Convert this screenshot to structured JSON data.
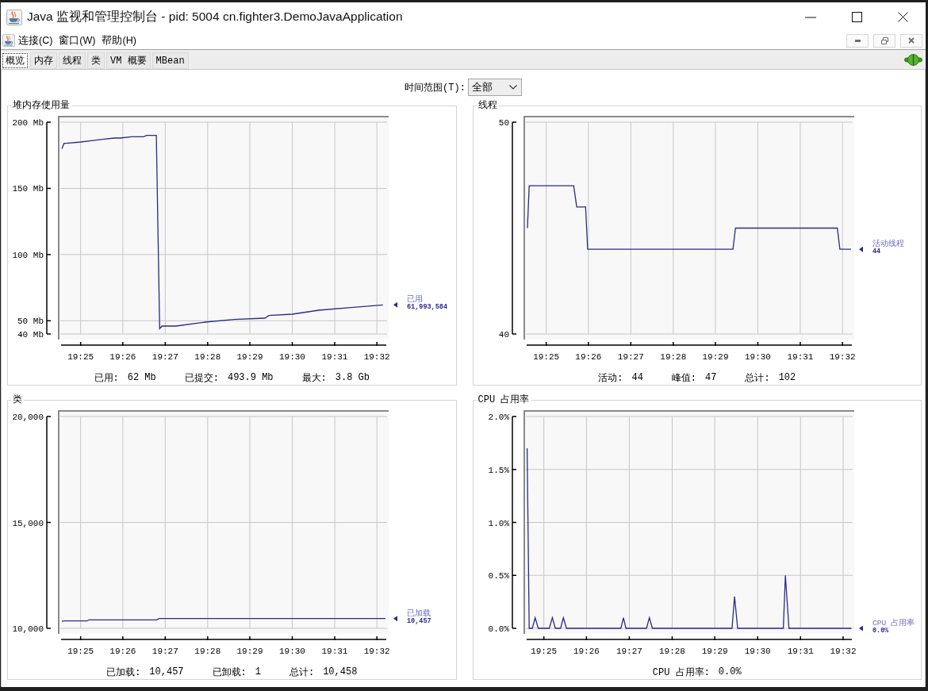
{
  "window": {
    "title": "Java 监视和管理控制台 - pid: 5004 cn.fighter3.DemoJavaApplication"
  },
  "menu": [
    {
      "label": "连接(C)"
    },
    {
      "label": "窗口(W)"
    },
    {
      "label": "帮助(H)"
    }
  ],
  "tabs": [
    {
      "label": "概览",
      "selected": true
    },
    {
      "label": "内存",
      "selected": false
    },
    {
      "label": "线程",
      "selected": false
    },
    {
      "label": "类",
      "selected": false
    },
    {
      "label": "VM 概要",
      "selected": false
    },
    {
      "label": "MBean",
      "selected": false
    }
  ],
  "time_range": {
    "label": "时间范围(T):",
    "value": "全部"
  },
  "panels": [
    {
      "title": "堆内存使用量",
      "legend_value": "61,993,584",
      "chart_data": {
        "type": "line",
        "xlim": [
          19.409,
          19.537
        ],
        "ylim": [
          40,
          200
        ],
        "xticks": [
          {
            "value": 19.4167,
            "label": "19:25"
          },
          {
            "value": 19.4333,
            "label": "19:26"
          },
          {
            "value": 19.45,
            "label": "19:27"
          },
          {
            "value": 19.4667,
            "label": "19:28"
          },
          {
            "value": 19.4833,
            "label": "19:29"
          },
          {
            "value": 19.5,
            "label": "19:30"
          },
          {
            "value": 19.5167,
            "label": "19:31"
          },
          {
            "value": 19.5333,
            "label": "19:32"
          }
        ],
        "yticks": [
          {
            "value": 200,
            "label": "200 Mb"
          },
          {
            "value": 150,
            "label": "150 Mb"
          },
          {
            "value": 100,
            "label": "100 Mb"
          },
          {
            "value": 50,
            "label": "50 Mb"
          },
          {
            "value": 40,
            "label": "40 Mb"
          }
        ],
        "grid": true,
        "legend": "right",
        "series": [
          {
            "name": "已用",
            "color": "#2a2a8c",
            "x": [
              19.4093,
              19.4102,
              19.411,
              19.4167,
              19.4208,
              19.4253,
              19.43,
              19.4323,
              19.4368,
              19.4415,
              19.4427,
              19.4465,
              19.4478,
              19.4487,
              19.4542,
              19.4657,
              19.4772,
              19.4892,
              19.4908,
              19.5,
              19.5105,
              19.5232,
              19.5357
            ],
            "values": [
              180,
              184,
              184,
              185,
              186,
              187,
              188,
              188,
              189,
              189,
              190,
              190,
              44,
              46,
              46,
              49,
              51,
              52,
              54,
              55,
              58,
              60,
              62
            ]
          }
        ]
      },
      "stats": [
        {
          "label": "已用:",
          "value": "62 Mb"
        },
        {
          "label": "已提交:",
          "value": "493.9 Mb"
        },
        {
          "label": "最大:",
          "value": "3.8 Gb"
        }
      ]
    },
    {
      "title": "线程",
      "legend_value": "44",
      "chart_data": {
        "type": "line",
        "xlim": [
          19.409,
          19.537
        ],
        "ylim": [
          40,
          50
        ],
        "xticks": [
          {
            "value": 19.4167,
            "label": "19:25"
          },
          {
            "value": 19.4333,
            "label": "19:26"
          },
          {
            "value": 19.45,
            "label": "19:27"
          },
          {
            "value": 19.4667,
            "label": "19:28"
          },
          {
            "value": 19.4833,
            "label": "19:29"
          },
          {
            "value": 19.5,
            "label": "19:30"
          },
          {
            "value": 19.5167,
            "label": "19:31"
          },
          {
            "value": 19.5333,
            "label": "19:32"
          }
        ],
        "yticks": [
          50,
          40
        ],
        "grid": true,
        "legend": "right",
        "series": [
          {
            "name": "活动线程",
            "color": "#2a2a8c",
            "x": [
              19.4093,
              19.41,
              19.4275,
              19.4287,
              19.4322,
              19.433,
              19.4902,
              19.4912,
              19.5313,
              19.5323,
              19.5367
            ],
            "values": [
              45,
              47,
              47,
              46,
              46,
              44,
              44,
              45,
              45,
              44,
              44
            ]
          }
        ]
      },
      "stats": [
        {
          "label": "活动:",
          "value": "44"
        },
        {
          "label": "峰值:",
          "value": "47"
        },
        {
          "label": "总计:",
          "value": "102"
        }
      ]
    },
    {
      "title": "类",
      "legend_value": "10,457",
      "chart_data": {
        "type": "line",
        "xlim": [
          19.409,
          19.537
        ],
        "ylim": [
          10000,
          20000
        ],
        "xticks": [
          {
            "value": 19.4167,
            "label": "19:25"
          },
          {
            "value": 19.4333,
            "label": "19:26"
          },
          {
            "value": 19.45,
            "label": "19:27"
          },
          {
            "value": 19.4667,
            "label": "19:28"
          },
          {
            "value": 19.4833,
            "label": "19:29"
          },
          {
            "value": 19.5,
            "label": "19:30"
          },
          {
            "value": 19.5167,
            "label": "19:31"
          },
          {
            "value": 19.5333,
            "label": "19:32"
          }
        ],
        "yticks": [
          {
            "value": 20000,
            "label": "20,000"
          },
          {
            "value": 15000,
            "label": "15,000"
          },
          {
            "value": 10000,
            "label": "10,000"
          }
        ],
        "grid": true,
        "legend": "right",
        "series": [
          {
            "name": "已加载",
            "color": "#2a2a8c",
            "x": [
              19.4093,
              19.41,
              19.4192,
              19.42,
              19.4467,
              19.4475,
              19.5367
            ],
            "values": [
              10330,
              10350,
              10350,
              10400,
              10400,
              10460,
              10460
            ]
          }
        ]
      },
      "stats": [
        {
          "label": "已加载:",
          "value": "10,457"
        },
        {
          "label": "已卸载:",
          "value": "1"
        },
        {
          "label": "总计:",
          "value": "10,458"
        }
      ]
    },
    {
      "title": "CPU 占用率",
      "legend_value": "0.0%",
      "chart_data": {
        "type": "line",
        "xlim": [
          19.41,
          19.5367
        ],
        "ylim": [
          0,
          2
        ],
        "xticks": [
          {
            "value": 19.4167,
            "label": "19:25"
          },
          {
            "value": 19.4333,
            "label": "19:26"
          },
          {
            "value": 19.45,
            "label": "19:27"
          },
          {
            "value": 19.4667,
            "label": "19:28"
          },
          {
            "value": 19.4833,
            "label": "19:29"
          },
          {
            "value": 19.5,
            "label": "19:30"
          },
          {
            "value": 19.5167,
            "label": "19:31"
          },
          {
            "value": 19.5333,
            "label": "19:32"
          }
        ],
        "yticks": [
          {
            "value": 2,
            "label": "2.0%"
          },
          {
            "value": 1.5,
            "label": "1.5%"
          },
          {
            "value": 1,
            "label": "1.0%"
          },
          {
            "value": 0.5,
            "label": "0.5%"
          },
          {
            "value": 0,
            "label": "0.0%"
          }
        ],
        "grid": true,
        "legend": "right",
        "series": [
          {
            "name": "CPU 占用率",
            "color": "#2a2a8c",
            "x": [
              19.4102,
              19.411,
              19.4122,
              19.4133,
              19.4145,
              19.4188,
              19.42,
              19.4212,
              19.4232,
              19.4243,
              19.4255,
              19.4467,
              19.4477,
              19.4487,
              19.4567,
              19.4578,
              19.459,
              19.49,
              19.491,
              19.4922,
              19.51,
              19.5108,
              19.5122,
              19.5365
            ],
            "values": [
              1.7,
              0,
              0,
              0.1,
              0,
              0,
              0.1,
              0,
              0,
              0.1,
              0,
              0,
              0.1,
              0,
              0,
              0.1,
              0,
              0,
              0.3,
              0,
              0,
              0.5,
              0,
              0
            ]
          }
        ]
      },
      "stats": [
        {
          "label": "CPU 占用率:",
          "value": "0.0%"
        }
      ]
    }
  ]
}
